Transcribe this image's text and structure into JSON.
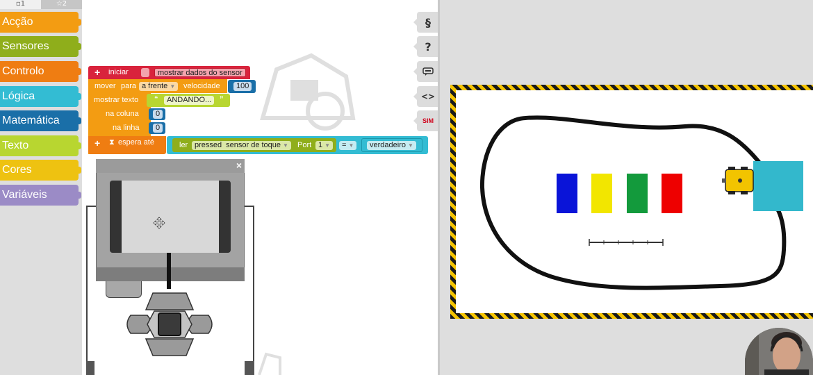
{
  "toolbox": {
    "tabs": [
      "▫1",
      "☆2"
    ],
    "categories": [
      {
        "label": "Acção",
        "color": "#f39c12"
      },
      {
        "label": "Sensores",
        "color": "#8fae1b"
      },
      {
        "label": "Controlo",
        "color": "#ef7d12"
      },
      {
        "label": "Lógica",
        "color": "#33bcd3"
      },
      {
        "label": "Matemática",
        "color": "#1a6fa8"
      },
      {
        "label": "Texto",
        "color": "#b8d630"
      },
      {
        "label": "Cores",
        "color": "#eec211"
      },
      {
        "label": "Variáveis",
        "color": "#9b8bc6"
      }
    ]
  },
  "side_buttons": {
    "code_icon": "code-icon",
    "help": "?",
    "comment_icon": "comment-icon",
    "source": "<>",
    "sim": "SIM"
  },
  "program": {
    "start_label": "iniciar",
    "show_sensor_data": "mostrar dados do sensor",
    "move_label": "mover",
    "para_label": "para",
    "direction": "a frente",
    "velocity_label": "velocidade",
    "velocity_value": "100",
    "show_text_label": "mostrar texto",
    "text_value": "ANDANDO...",
    "column_label": "na coluna",
    "column_value": "0",
    "row_label": "na linha",
    "row_value": "0",
    "wait_until_label": "espera até",
    "read_label": "ler",
    "sensor_mode": "pressed",
    "sensor_type": "sensor de toque",
    "port_label": "Port",
    "port_value": "1",
    "operator": "=",
    "bool_value": "verdadeiro",
    "colors": {
      "start": "#d9233c",
      "action": "#f39c12",
      "sensor": "#8fae1b",
      "logic": "#33bcd3",
      "math": "#1a6fa8",
      "text": "#b8d630"
    }
  },
  "brick": {
    "close": "×"
  },
  "simulator": {
    "color_blocks": [
      "#0a14d8",
      "#f2e600",
      "#139a3c",
      "#ee0000"
    ],
    "robot_color": "#f2c400",
    "wall_color": "#33b8cc"
  }
}
